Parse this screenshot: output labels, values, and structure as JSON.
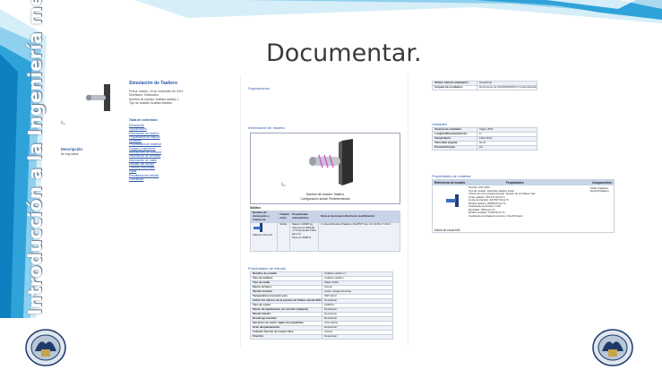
{
  "slide": {
    "title": "Documentar.",
    "vertical_title": "Introducción a la Ingeniería mecánica",
    "colors": {
      "banner_blue": "#2fa3d9",
      "banner_light": "#bfe3f3",
      "title_text": "#3a3a3a",
      "link_blue": "#2b57a8",
      "table_header": "#c8d4e8"
    },
    "icons": {
      "left_logo": "unam-seal-icon",
      "right_logo": "fi-unam-seal-icon"
    }
  },
  "page1": {
    "title": "Simulación de Taaliero",
    "meta": [
      "Fecha: martes, 16 de noviembre de 2014",
      "Diseñador: Solidworks",
      "Nombre de estudio: Análisis estático 1",
      "Tipo de análisis: Análisis estático"
    ],
    "toc_heading": "Tabla de contenidos",
    "toc_items": [
      "Descripción",
      "Suposiciones",
      "Información de modelo",
      "Propiedades de estudio",
      "Unidades",
      "Propiedades de material",
      "Cargas y sujeciones",
      "Definiciones de conector",
      "Información de contacto",
      "Información de malla",
      "Detalles del sensor",
      "Fuerzas resultantes",
      "Vigas",
      "Resultados del estudio",
      "Conclusión"
    ],
    "desc_heading": "Descripción",
    "desc_text": "No hay datos"
  },
  "page2": {
    "assumptions_heading": "Suposiciones",
    "model_info_heading": "Información de modelo",
    "model_caption_1": "Nombre del modelo: Taaliero",
    "model_caption_2": "Configuración actual: Predeterminado",
    "solids_label": "Sólidos",
    "solids_headers": [
      "Nombre de documento y referencia",
      "Tratado como",
      "Propiedades volumétricas",
      "Ruta al documento/Fecha de modificación"
    ],
    "solids_row": [
      "Saliente-Extruir2",
      "Sólido",
      "Masa:1.16928 kg Volumen:0.000148 m^3 Densidad:7900 kg/m^3 Peso:11.4589 N",
      "C:\\Users\\Desktop\\Taaliero.SLDPRT Nov 16 13:45:17 2014"
    ],
    "study_props_heading": "Propiedades de estudio",
    "study_props": [
      [
        "Nombre de estudio",
        "Análisis estático 1"
      ],
      [
        "Tipo de análisis",
        "Análisis estático"
      ],
      [
        "Tipo de malla",
        "Malla sólida"
      ],
      [
        "Efecto térmico:",
        "Activar"
      ],
      [
        "Opción térmica",
        "Incluir cargas térmicas"
      ],
      [
        "Temperatura a tensión cero",
        "298 Kelvin"
      ],
      [
        "Incluir los efectos de la presión de fluidos desde SOLIDWORKS Flow Simulation",
        "Desactivar"
      ],
      [
        "Tipo de solver",
        "FFEPlus"
      ],
      [
        "Efecto de rigidización por tensión (Inplane):",
        "Desactivar"
      ],
      [
        "Muelle blando:",
        "Desactivar"
      ],
      [
        "Desahogo inercial:",
        "Desactivar"
      ],
      [
        "Opciones de unión rígida incompatibles",
        "Automática"
      ],
      [
        "Gran desplazamiento",
        "Desactivar"
      ],
      [
        "Calcular fuerzas de cuerpo libre",
        "Activar"
      ],
      [
        "Fricción",
        "Desactivar"
      ]
    ]
  },
  "page3": {
    "top_rows": [
      [
        "Utilizar método adaptativo:",
        "Desactivar"
      ],
      [
        "Carpeta de resultados",
        "Documento de SOLIDWORKS (C:\\Users\\Desktop\\Taaliero)"
      ]
    ],
    "units_heading": "Unidades",
    "units_rows": [
      [
        "Sistema de unidades:",
        "Inglés (IPS)"
      ],
      [
        "Longitud/Desplazamiento",
        "in"
      ],
      [
        "Temperatura",
        "Fahrenheit"
      ],
      [
        "Velocidad angular",
        "Hertz"
      ],
      [
        "Presión/Tensión",
        "psi"
      ]
    ],
    "materials_heading": "Propiedades de material",
    "materials_headers": [
      "Referencia de modelo",
      "Propiedades",
      "Componentes"
    ],
    "materials_props": [
      "Nombre: AISI 1020",
      "Tipo de modelo: Isotrópico elástico lineal",
      "Criterio de error predeterminado: Tensión de von Mises máx.",
      "Límite elástico: 351.571 N/mm^2",
      "Límite de tracción: 420.507 N/mm^2",
      "Módulo elástico: 200000 N/mm^2",
      "Coeficiente de Poisson: 0.29",
      "Densidad: 7900 g/cm^3",
      "Módulo cortante: 77000 N/mm^2",
      "Coeficiente de dilatación térmica: 1.5e-05 /Kelvin"
    ],
    "materials_component": "Sólido 1(Saliente-Extruir2)(Taaliero)",
    "curve_label": "Datos de curva:N/A"
  }
}
